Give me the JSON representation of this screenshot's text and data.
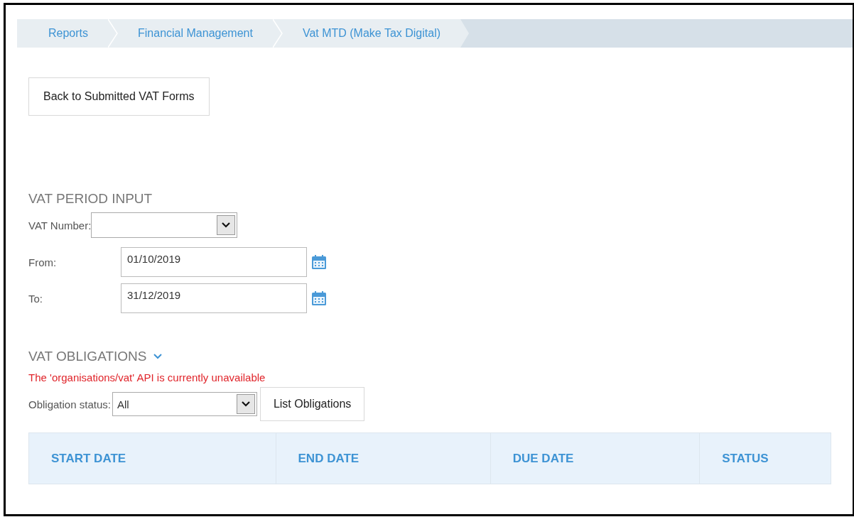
{
  "breadcrumb": [
    {
      "label": "Reports"
    },
    {
      "label": "Financial Management"
    },
    {
      "label": "Vat MTD (Make Tax Digital)"
    }
  ],
  "back_button": "Back to Submitted VAT Forms",
  "period_input": {
    "title": "VAT PERIOD INPUT",
    "vat_number": {
      "label": "VAT Number:"
    },
    "from": {
      "label": "From:",
      "value": "01/10/2019"
    },
    "to": {
      "label": "To:",
      "value": "31/12/2019"
    }
  },
  "obligations": {
    "title": "VAT OBLIGATIONS",
    "expanded": true,
    "error": "The 'organisations/vat' API is currently unavailable",
    "status_label": "Obligation status:",
    "status_value": "All",
    "list_button": "List Obligations",
    "table": {
      "columns": [
        "START DATE",
        "END DATE",
        "DUE DATE",
        "STATUS"
      ]
    }
  }
}
